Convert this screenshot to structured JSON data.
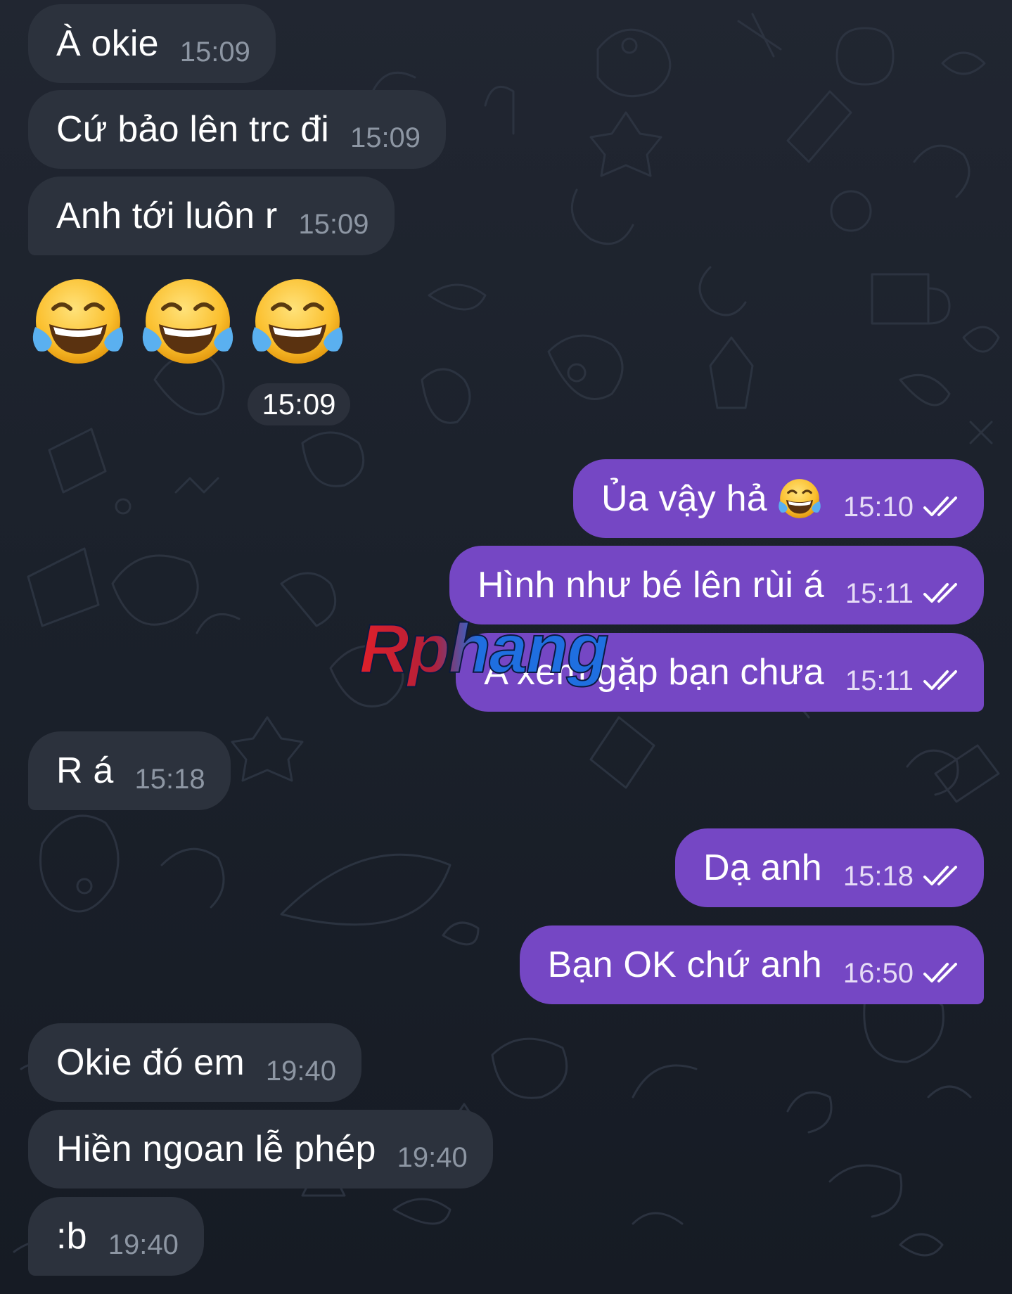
{
  "chat": {
    "messages": [
      {
        "side": "in",
        "text": "À okie",
        "time": "15:09"
      },
      {
        "side": "in",
        "text": "Cứ bảo lên trc đi",
        "time": "15:09"
      },
      {
        "side": "in",
        "text": "Anh tới luôn r",
        "time": "15:09"
      },
      {
        "side": "in",
        "emoji": "😂😂😂",
        "emoji_icon": "face-with-tears-of-joy-icon",
        "time": "15:09"
      },
      {
        "side": "out",
        "text": "Ủa vậy hả",
        "emoji_icon": "face-with-tears-of-joy-icon",
        "time": "15:10",
        "status_icon": "double-check-icon"
      },
      {
        "side": "out",
        "text": "Hình như bé lên rùi á",
        "time": "15:11",
        "status_icon": "double-check-icon"
      },
      {
        "side": "out",
        "text": "A xem gặp bạn chưa",
        "time": "15:11",
        "status_icon": "double-check-icon"
      },
      {
        "side": "in",
        "text": "R á",
        "time": "15:18"
      },
      {
        "side": "out",
        "text": "Dạ anh",
        "time": "15:18",
        "status_icon": "double-check-icon"
      },
      {
        "side": "out",
        "text": "Bạn OK chứ anh",
        "time": "16:50",
        "status_icon": "double-check-icon"
      },
      {
        "side": "in",
        "text": "Okie đó em",
        "time": "19:40"
      },
      {
        "side": "in",
        "text": "Hiền ngoan lễ phép",
        "time": "19:40"
      },
      {
        "side": "in",
        "text": ":b",
        "time": "19:40"
      }
    ]
  },
  "watermark": {
    "text": "Rphang"
  },
  "colors": {
    "background": "#1b212b",
    "incoming_bubble": "#2c323d",
    "outgoing_bubble": "#7547c4",
    "incoming_time": "#8d96a3",
    "outgoing_time": "#e6dcf6",
    "watermark_red": "#e0202a",
    "watermark_blue": "#1f6fe0"
  }
}
